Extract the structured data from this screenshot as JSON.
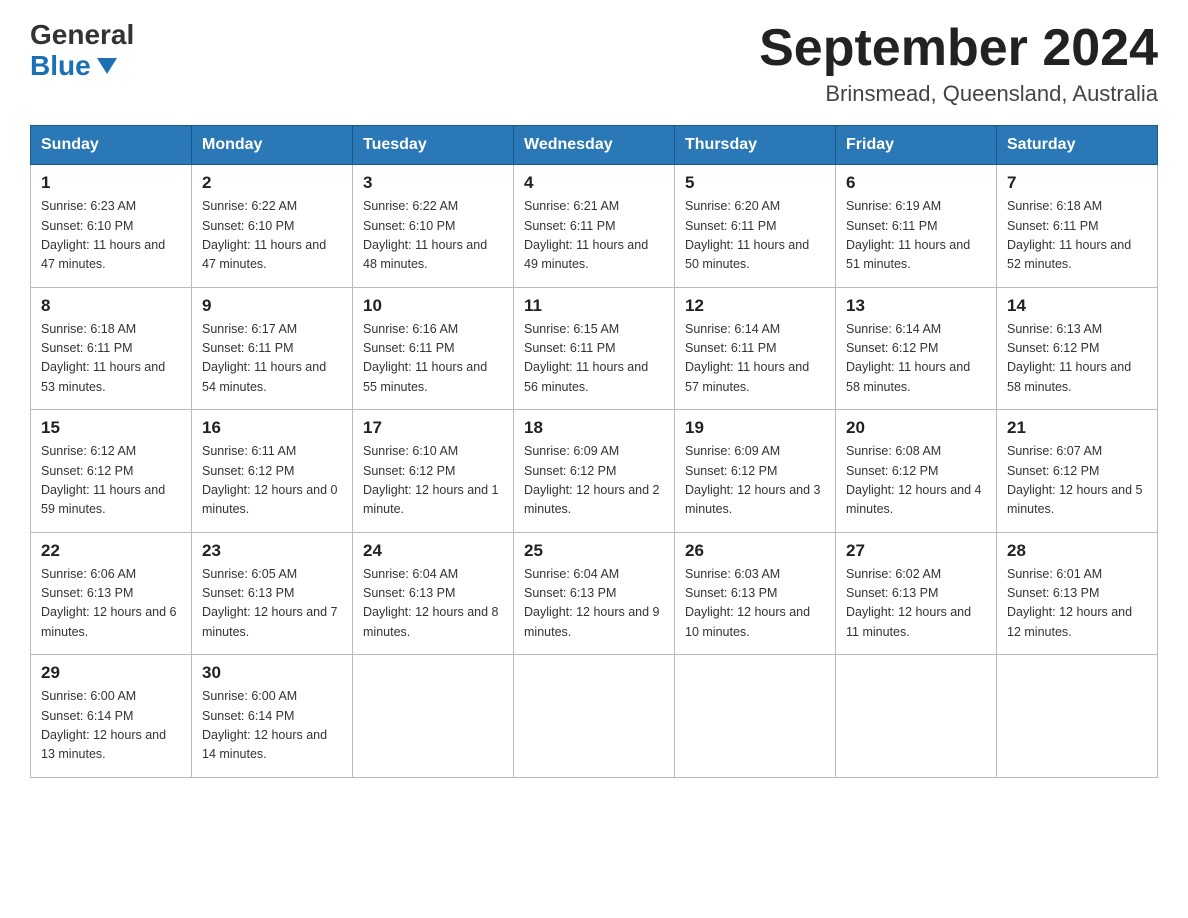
{
  "logo": {
    "general": "General",
    "blue": "Blue"
  },
  "title": {
    "month_year": "September 2024",
    "location": "Brinsmead, Queensland, Australia"
  },
  "weekdays": [
    "Sunday",
    "Monday",
    "Tuesday",
    "Wednesday",
    "Thursday",
    "Friday",
    "Saturday"
  ],
  "weeks": [
    [
      {
        "day": 1,
        "sunrise": "6:23 AM",
        "sunset": "6:10 PM",
        "daylight": "11 hours and 47 minutes."
      },
      {
        "day": 2,
        "sunrise": "6:22 AM",
        "sunset": "6:10 PM",
        "daylight": "11 hours and 47 minutes."
      },
      {
        "day": 3,
        "sunrise": "6:22 AM",
        "sunset": "6:10 PM",
        "daylight": "11 hours and 48 minutes."
      },
      {
        "day": 4,
        "sunrise": "6:21 AM",
        "sunset": "6:11 PM",
        "daylight": "11 hours and 49 minutes."
      },
      {
        "day": 5,
        "sunrise": "6:20 AM",
        "sunset": "6:11 PM",
        "daylight": "11 hours and 50 minutes."
      },
      {
        "day": 6,
        "sunrise": "6:19 AM",
        "sunset": "6:11 PM",
        "daylight": "11 hours and 51 minutes."
      },
      {
        "day": 7,
        "sunrise": "6:18 AM",
        "sunset": "6:11 PM",
        "daylight": "11 hours and 52 minutes."
      }
    ],
    [
      {
        "day": 8,
        "sunrise": "6:18 AM",
        "sunset": "6:11 PM",
        "daylight": "11 hours and 53 minutes."
      },
      {
        "day": 9,
        "sunrise": "6:17 AM",
        "sunset": "6:11 PM",
        "daylight": "11 hours and 54 minutes."
      },
      {
        "day": 10,
        "sunrise": "6:16 AM",
        "sunset": "6:11 PM",
        "daylight": "11 hours and 55 minutes."
      },
      {
        "day": 11,
        "sunrise": "6:15 AM",
        "sunset": "6:11 PM",
        "daylight": "11 hours and 56 minutes."
      },
      {
        "day": 12,
        "sunrise": "6:14 AM",
        "sunset": "6:11 PM",
        "daylight": "11 hours and 57 minutes."
      },
      {
        "day": 13,
        "sunrise": "6:14 AM",
        "sunset": "6:12 PM",
        "daylight": "11 hours and 58 minutes."
      },
      {
        "day": 14,
        "sunrise": "6:13 AM",
        "sunset": "6:12 PM",
        "daylight": "11 hours and 58 minutes."
      }
    ],
    [
      {
        "day": 15,
        "sunrise": "6:12 AM",
        "sunset": "6:12 PM",
        "daylight": "11 hours and 59 minutes."
      },
      {
        "day": 16,
        "sunrise": "6:11 AM",
        "sunset": "6:12 PM",
        "daylight": "12 hours and 0 minutes."
      },
      {
        "day": 17,
        "sunrise": "6:10 AM",
        "sunset": "6:12 PM",
        "daylight": "12 hours and 1 minute."
      },
      {
        "day": 18,
        "sunrise": "6:09 AM",
        "sunset": "6:12 PM",
        "daylight": "12 hours and 2 minutes."
      },
      {
        "day": 19,
        "sunrise": "6:09 AM",
        "sunset": "6:12 PM",
        "daylight": "12 hours and 3 minutes."
      },
      {
        "day": 20,
        "sunrise": "6:08 AM",
        "sunset": "6:12 PM",
        "daylight": "12 hours and 4 minutes."
      },
      {
        "day": 21,
        "sunrise": "6:07 AM",
        "sunset": "6:12 PM",
        "daylight": "12 hours and 5 minutes."
      }
    ],
    [
      {
        "day": 22,
        "sunrise": "6:06 AM",
        "sunset": "6:13 PM",
        "daylight": "12 hours and 6 minutes."
      },
      {
        "day": 23,
        "sunrise": "6:05 AM",
        "sunset": "6:13 PM",
        "daylight": "12 hours and 7 minutes."
      },
      {
        "day": 24,
        "sunrise": "6:04 AM",
        "sunset": "6:13 PM",
        "daylight": "12 hours and 8 minutes."
      },
      {
        "day": 25,
        "sunrise": "6:04 AM",
        "sunset": "6:13 PM",
        "daylight": "12 hours and 9 minutes."
      },
      {
        "day": 26,
        "sunrise": "6:03 AM",
        "sunset": "6:13 PM",
        "daylight": "12 hours and 10 minutes."
      },
      {
        "day": 27,
        "sunrise": "6:02 AM",
        "sunset": "6:13 PM",
        "daylight": "12 hours and 11 minutes."
      },
      {
        "day": 28,
        "sunrise": "6:01 AM",
        "sunset": "6:13 PM",
        "daylight": "12 hours and 12 minutes."
      }
    ],
    [
      {
        "day": 29,
        "sunrise": "6:00 AM",
        "sunset": "6:14 PM",
        "daylight": "12 hours and 13 minutes."
      },
      {
        "day": 30,
        "sunrise": "6:00 AM",
        "sunset": "6:14 PM",
        "daylight": "12 hours and 14 minutes."
      },
      null,
      null,
      null,
      null,
      null
    ]
  ]
}
